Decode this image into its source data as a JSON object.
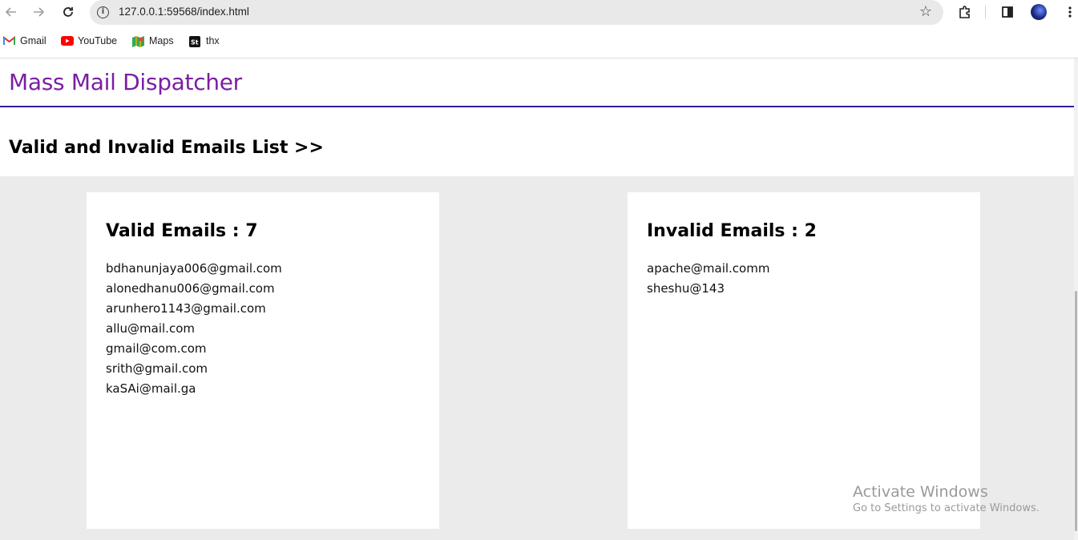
{
  "browser": {
    "url": "127.0.0.1:59568/index.html",
    "bookmarks": [
      {
        "label": "Gmail",
        "icon": "gmail-icon"
      },
      {
        "label": "YouTube",
        "icon": "youtube-icon"
      },
      {
        "label": "Maps",
        "icon": "maps-icon"
      },
      {
        "label": "thx",
        "icon": "st-icon"
      }
    ]
  },
  "app": {
    "title": "Mass Mail Dispatcher",
    "section_heading": "Valid and Invalid Emails List >>"
  },
  "valid": {
    "heading": "Valid Emails : 7",
    "emails": [
      "bdhanunjaya006@gmail.com",
      "alonedhanu006@gmail.com",
      "arunhero1143@gmail.com",
      "allu@mail.com",
      "gmail@com.com",
      "srith@gmail.com",
      "kaSAi@mail.ga"
    ]
  },
  "invalid": {
    "heading": "Invalid Emails : 2",
    "emails": [
      "apache@mail.comm",
      "sheshu@143"
    ]
  },
  "watermark": {
    "line1": "Activate Windows",
    "line2": "Go to Settings to activate Windows."
  },
  "colors": {
    "title": "#7a1fa2",
    "rule": "#3a1b9e",
    "panel_bg": "#ebebeb"
  }
}
